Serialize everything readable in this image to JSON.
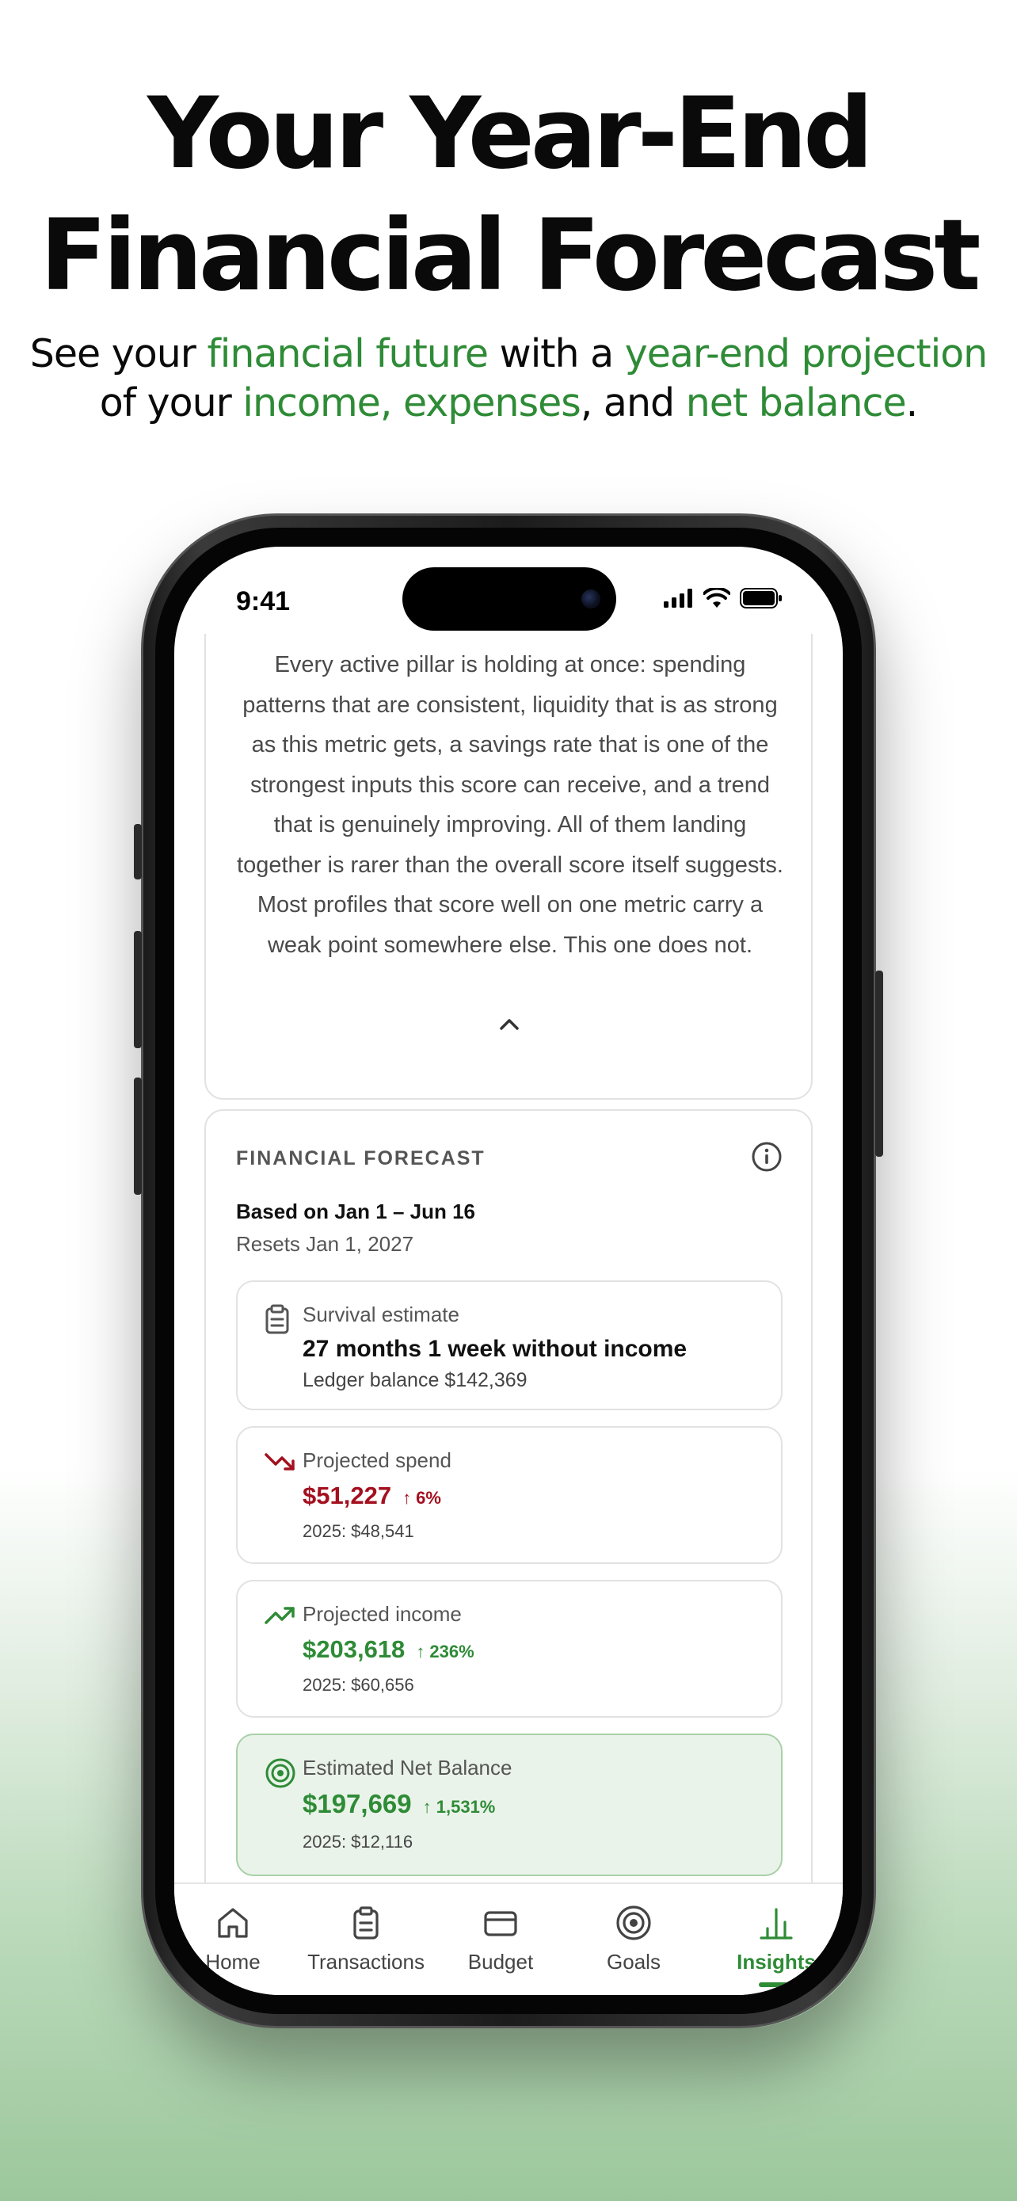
{
  "headline": {
    "line1": "Your Year-End",
    "line2": "Financial Forecast"
  },
  "subhead": {
    "t1": "See your ",
    "g1": "financial future",
    "t2": " with a ",
    "g2": "year-end projection",
    "t3": "of your ",
    "g3": "income, expenses",
    "t4": ", and ",
    "g4": "net balance",
    "t5": "."
  },
  "status_bar": {
    "time": "9:41",
    "icons": [
      "signal-icon",
      "wifi-icon",
      "battery-icon"
    ]
  },
  "insight_card": {
    "paragraph": "Every active pillar is holding at once: spending patterns that are consistent, liquidity that is as strong as this metric gets, a savings rate that is one of the strongest inputs this score can receive, and a trend that is genuinely improving. All of them landing together is rarer than the overall score itself suggests. Most profiles that score well on one metric carry a weak point somewhere else. This one does not.",
    "collapse_icon": "chevron-up-icon"
  },
  "forecast": {
    "title": "FINANCIAL FORECAST",
    "based_on": "Based on Jan 1 – Jun 16",
    "resets": "Resets Jan 1, 2027",
    "survival": {
      "label": "Survival estimate",
      "value": "27 months 1 week without income",
      "sub": "Ledger balance $142,369",
      "icon": "clipboard-icon"
    },
    "spend": {
      "label": "Projected spend",
      "value": "$51,227",
      "change": "↑ 6%",
      "prior": "2025: $48,541",
      "icon": "trend-down-icon",
      "color": "#a4101f"
    },
    "income": {
      "label": "Projected income",
      "value": "$203,618",
      "change": "↑ 236%",
      "prior": "2025: $60,656",
      "icon": "trend-up-icon",
      "color": "#2e8b36"
    },
    "net": {
      "label": "Estimated Net Balance",
      "value": "$197,669",
      "change": "↑ 1,531%",
      "prior": "2025: $12,116",
      "icon": "target-icon",
      "color": "#2e8b36"
    }
  },
  "tabs": [
    {
      "label": "Home",
      "icon": "home-icon"
    },
    {
      "label": "Transactions",
      "icon": "clipboard-icon"
    },
    {
      "label": "Budget",
      "icon": "card-icon"
    },
    {
      "label": "Goals",
      "icon": "target-icon"
    },
    {
      "label": "Insights",
      "icon": "bar-chart-icon",
      "active": true
    }
  ],
  "colors": {
    "accent_green": "#2e8b36",
    "negative_red": "#a4101f"
  }
}
